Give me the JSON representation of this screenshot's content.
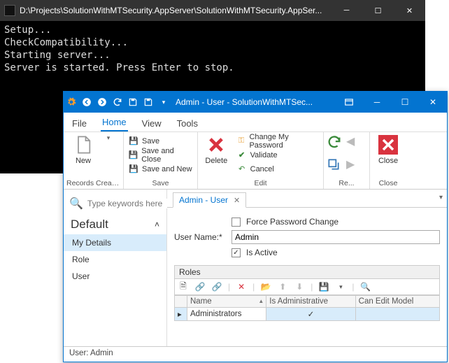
{
  "console": {
    "title": "D:\\Projects\\SolutionWithMTSecurity.AppServer\\SolutionWithMTSecurity.AppSer...",
    "lines": "Setup...\nCheckCompatibility...\nStarting server...\nServer is started. Press Enter to stop."
  },
  "app": {
    "title": "Admin - User - SolutionWithMTSec...",
    "menus": {
      "file": "File",
      "home": "Home",
      "view": "View",
      "tools": "Tools"
    },
    "ribbon": {
      "records_creation": {
        "label": "Records Creation",
        "new": "New"
      },
      "save": {
        "label": "Save",
        "save": "Save",
        "save_close": "Save and Close",
        "save_new": "Save and New"
      },
      "edit": {
        "label": "Edit",
        "delete": "Delete",
        "change_pw": "Change My Password",
        "validate": "Validate",
        "cancel": "Cancel"
      },
      "refresh": {
        "label": "Re..."
      },
      "close": {
        "label": "Close",
        "close": "Close"
      }
    },
    "search": {
      "placeholder": "Type keywords here"
    },
    "sidebar": {
      "header": "Default",
      "items": [
        "My Details",
        "Role",
        "User"
      ]
    },
    "tab": {
      "label": "Admin - User"
    },
    "form": {
      "force_pw": "Force Password Change",
      "user_name_label": "User Name:*",
      "user_name_value": "Admin",
      "is_active": "Is Active",
      "roles_panel": "Roles",
      "col_name": "Name",
      "col_admin": "Is Administrative",
      "col_edit": "Can Edit Model",
      "row_name": "Administrators"
    },
    "status": "User: Admin"
  }
}
